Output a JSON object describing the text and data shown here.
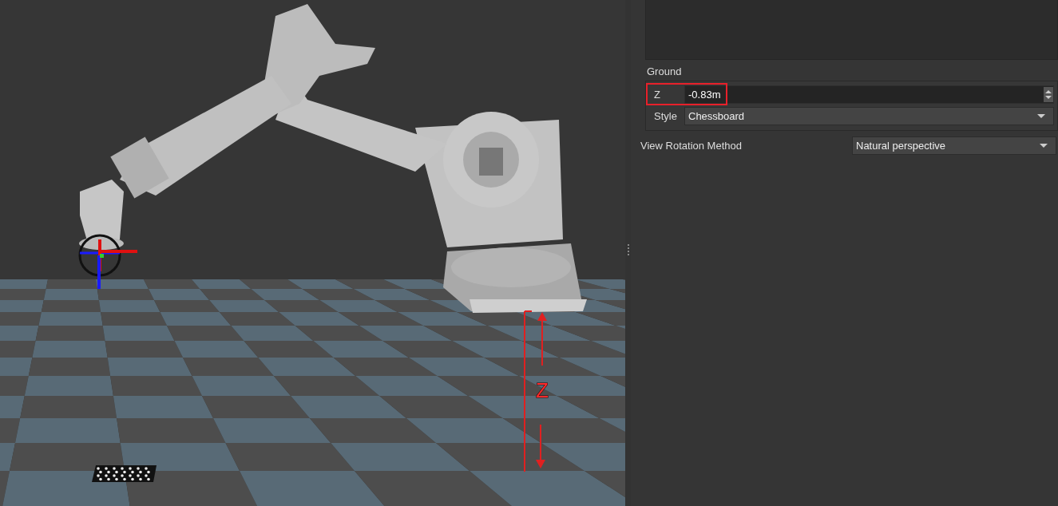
{
  "viewport": {
    "annotation_label": "Z"
  },
  "properties": {
    "group_title": "Ground",
    "fields": [
      {
        "kind": "spinbox",
        "label": "Z",
        "value": "-0.83m",
        "highlighted": true
      },
      {
        "kind": "dropdown",
        "label": "Style",
        "value": "Chessboard",
        "highlighted": false
      }
    ],
    "view_rotation": {
      "label": "View Rotation Method",
      "value": "Natural perspective"
    }
  }
}
